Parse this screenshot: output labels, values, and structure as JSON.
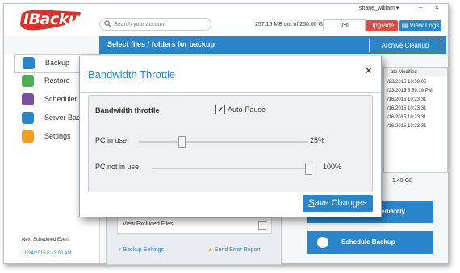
{
  "app": {
    "logo": "IBackup",
    "user": "shane_william",
    "window_controls": {
      "minimize": "–",
      "close": "×"
    },
    "search": {
      "placeholder": "Search your account"
    },
    "storage_text": "257.15 MB out of 250.00 GB",
    "progress_text": "0%",
    "upgrade_label": "Upgrade",
    "view_logs_label": "View Logs",
    "section_title": "Select files / folders for backup",
    "archive_cleanup_label": "Archive Cleanup"
  },
  "sidebar": {
    "items": [
      {
        "label": "Backup",
        "icon": "backup-cloud-icon",
        "color": "#2a86c8"
      },
      {
        "label": "Restore",
        "icon": "restore-cloud-icon",
        "color": "#4caf50"
      },
      {
        "label": "Scheduler",
        "icon": "clock-icon",
        "color": "#7b4fa0"
      },
      {
        "label": "Server Back",
        "icon": "server-icon",
        "color": "#2a86c8"
      },
      {
        "label": "Settings",
        "icon": "gear-icon",
        "color": "#f0a020"
      }
    ],
    "next_event_label": "Next Scheduled Event",
    "next_event_value": "11/24/2015 6:12:00 AM"
  },
  "file_table": {
    "header": "ate Modified",
    "rows": [
      "/23/2015 10:59:05",
      "/23/2015 5:59:19 PM",
      "/16/2015 10:23:31",
      "/16/2015 10:23:31",
      "/16/2015 10:23:31",
      "/16/2015 10:23:31"
    ],
    "size": "1.49 GB"
  },
  "actions": {
    "backup_now_label": "mediately",
    "schedule_backup_label": "Schedule Backup",
    "view_excluded_label": "View Excluded Files",
    "backup_settings_label": "Backup Settings",
    "send_error_label": "Send Error Report"
  },
  "dialog": {
    "title": "Bandwidth Throttle",
    "close": "×",
    "section_heading": "Bandwidth throttle",
    "auto_pause_label": "Auto-Pause",
    "auto_pause_checked": true,
    "pc_in_use_label": "PC in use",
    "pc_in_use_value": "25%",
    "pc_in_use_level": 0.25,
    "pc_not_in_use_label": "PC not in use",
    "pc_not_in_use_value": "100%",
    "pc_not_in_use_level": 1.0,
    "save_mnemonic": "S",
    "save_rest": "ave Changes"
  },
  "colors": {
    "accent": "#2a86c8",
    "upgrade": "#d94f45"
  }
}
